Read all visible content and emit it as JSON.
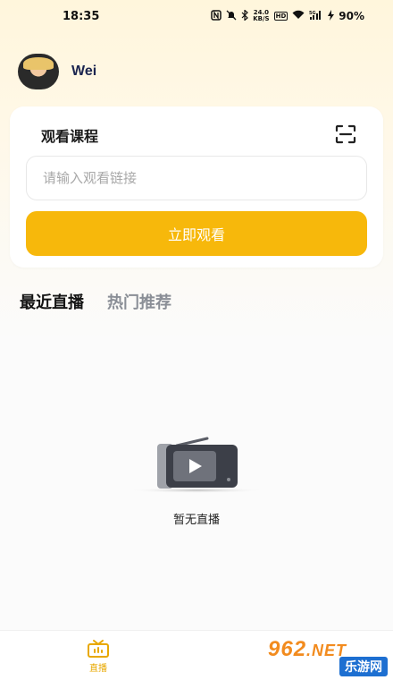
{
  "status_bar": {
    "time": "18:35",
    "net_speed_value": "24.0",
    "net_speed_unit": "KB/S",
    "hd_badge": "HD",
    "signal_label": "5G",
    "battery": "90%"
  },
  "user": {
    "name": "Wei"
  },
  "card": {
    "title": "观看课程",
    "input_placeholder": "请输入观看链接",
    "input_value": "",
    "watch_button": "立即观看"
  },
  "tabs": [
    {
      "label": "最近直播",
      "active": true
    },
    {
      "label": "热门推荐",
      "active": false
    }
  ],
  "empty_state": {
    "text": "暂无直播"
  },
  "bottom_nav": {
    "items": [
      {
        "label": "直播",
        "icon": "live-icon",
        "active": true
      }
    ]
  },
  "watermark": {
    "brand": "962",
    "suffix": ".NET",
    "sub": "乐游网"
  },
  "colors": {
    "accent": "#f7b80b",
    "tab_inactive": "#8a8e96",
    "title_dark": "#1b2550"
  }
}
